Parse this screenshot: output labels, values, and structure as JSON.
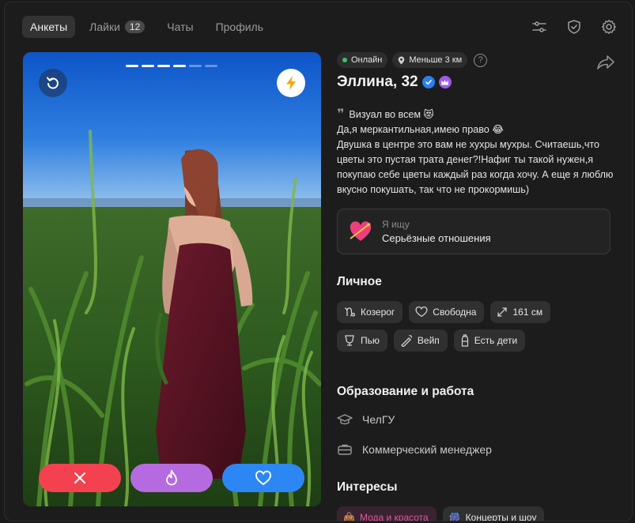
{
  "nav": {
    "tabs": [
      {
        "label": "Анкеты",
        "active": true
      },
      {
        "label": "Лайки",
        "count": "12"
      },
      {
        "label": "Чаты"
      },
      {
        "label": "Профиль"
      }
    ],
    "icons": [
      "filters-icon",
      "shield-icon",
      "gear-icon"
    ]
  },
  "card": {
    "photo_count": 6,
    "current_photo": 4,
    "actions": [
      "dislike",
      "superlike",
      "like"
    ]
  },
  "profile": {
    "status_online": "Онлайн",
    "distance": "Меньше 3 км",
    "help": "?",
    "name_age": "Эллина, 32",
    "bio": "Визуал во всем 😻\nДа,я меркантильная,имею право 😂\nДвушка в центре это вам не хухры мухры. Считаешь,что цветы это пустая трата денег?!Нафиг ты такой нужен,я покупаю себе цветы каждый раз когда хочу. А еще я люблю вкусно покушать, так что не прокормишь)",
    "seeking_label": "Я ищу",
    "seeking_value": "Серьёзные отношения"
  },
  "personal": {
    "title": "Личное",
    "chips": [
      {
        "icon": "capricorn-icon",
        "label": "Козерог"
      },
      {
        "icon": "heart-outline-icon",
        "label": "Свободна"
      },
      {
        "icon": "height-icon",
        "label": "161 см"
      },
      {
        "icon": "glass-icon",
        "label": "Пью"
      },
      {
        "icon": "vape-icon",
        "label": "Вейп"
      },
      {
        "icon": "bottle-icon",
        "label": "Есть дети"
      }
    ]
  },
  "education": {
    "title": "Образование и работа",
    "university": "ЧелГУ",
    "job": "Коммерческий менеджер"
  },
  "interests": {
    "title": "Интересы",
    "items": [
      {
        "label": "Мода и красота",
        "color": "#e0559f",
        "bg": "#3a2330"
      },
      {
        "label": "Концерты и шоу",
        "color": "#ececec",
        "bg": "#303030"
      }
    ]
  },
  "colors": {
    "dislike": "#f4414f",
    "superlike": "#b66ae0",
    "like": "#2c86f4",
    "online": "#37c26a",
    "verified": "#2a7ff0",
    "premium": "#9b5ce8"
  }
}
